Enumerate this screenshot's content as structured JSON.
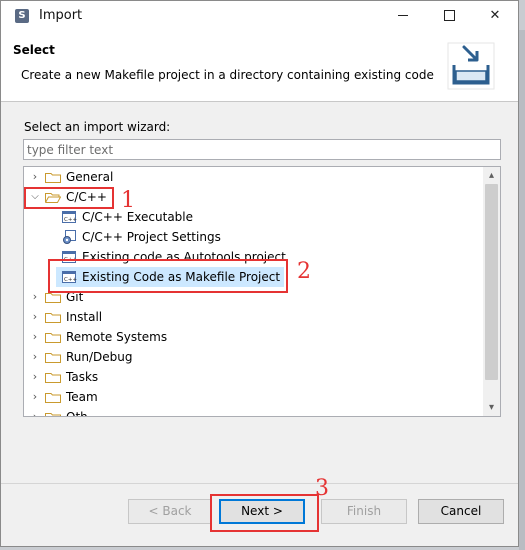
{
  "window": {
    "title": "Import",
    "app_icon": "eclipse-icon",
    "controls": {
      "minimize": "minimize-icon",
      "maximize": "maximize-icon",
      "close": "✕"
    }
  },
  "header": {
    "title": "Select",
    "description": "Create a new Makefile project in a directory containing existing code",
    "icon": "import-tray-icon"
  },
  "wizard": {
    "label": "Select an import wizard:",
    "filter_placeholder": "type filter text",
    "filter_value": ""
  },
  "tree": {
    "items": [
      {
        "label": "General",
        "expanded": false,
        "icon": "folder-icon"
      },
      {
        "label": "C/C++",
        "expanded": true,
        "icon": "folder-open-icon",
        "children": [
          {
            "label": "C/C++ Executable",
            "icon": "cpp-file-icon"
          },
          {
            "label": "C/C++ Project Settings",
            "icon": "cpp-settings-icon"
          },
          {
            "label": "Existing code as Autotools project",
            "icon": "cpp-file-icon"
          },
          {
            "label": "Existing Code as Makefile Project",
            "icon": "cpp-file-icon",
            "selected": true
          }
        ]
      },
      {
        "label": "Git",
        "expanded": false,
        "icon": "folder-icon"
      },
      {
        "label": "Install",
        "expanded": false,
        "icon": "folder-icon"
      },
      {
        "label": "Remote Systems",
        "expanded": false,
        "icon": "folder-icon"
      },
      {
        "label": "Run/Debug",
        "expanded": false,
        "icon": "folder-icon"
      },
      {
        "label": "Tasks",
        "expanded": false,
        "icon": "folder-icon"
      },
      {
        "label": "Team",
        "expanded": false,
        "icon": "folder-icon"
      },
      {
        "label": "Oth",
        "expanded": false,
        "icon": "folder-icon"
      }
    ]
  },
  "buttons": {
    "back": "< Back",
    "next": "Next >",
    "finish": "Finish",
    "cancel": "Cancel"
  },
  "annotations": {
    "step1": "1",
    "step2": "2",
    "step3": "3",
    "color": "#e53333"
  },
  "colors": {
    "selection": "#cce8ff",
    "accent": "#0078d7",
    "folder": "#e8b64c"
  }
}
